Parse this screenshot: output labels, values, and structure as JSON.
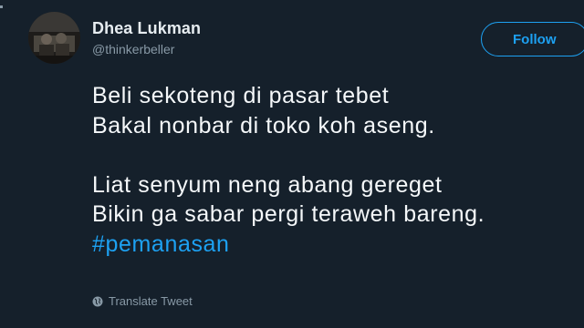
{
  "user": {
    "display_name": "Dhea Lukman",
    "handle": "@thinkerbeller",
    "avatar_icon": "profile-photo"
  },
  "follow_button": {
    "label": "Follow",
    "color": "#1da1f2"
  },
  "tweet": {
    "lines_block1": [
      "Beli sekoteng di pasar tebet",
      "Bakal nonbar di toko koh aseng."
    ],
    "lines_block2": [
      "Liat senyum neng abang gereget",
      "Bikin ga sabar pergi teraweh bareng."
    ],
    "hashtag": "#pemanasan"
  },
  "translate": {
    "label": "Translate Tweet",
    "icon": "globe-icon"
  },
  "colors": {
    "background": "#15202b",
    "text": "#f5f8fa",
    "muted": "#8899a6",
    "accent": "#1da1f2"
  }
}
